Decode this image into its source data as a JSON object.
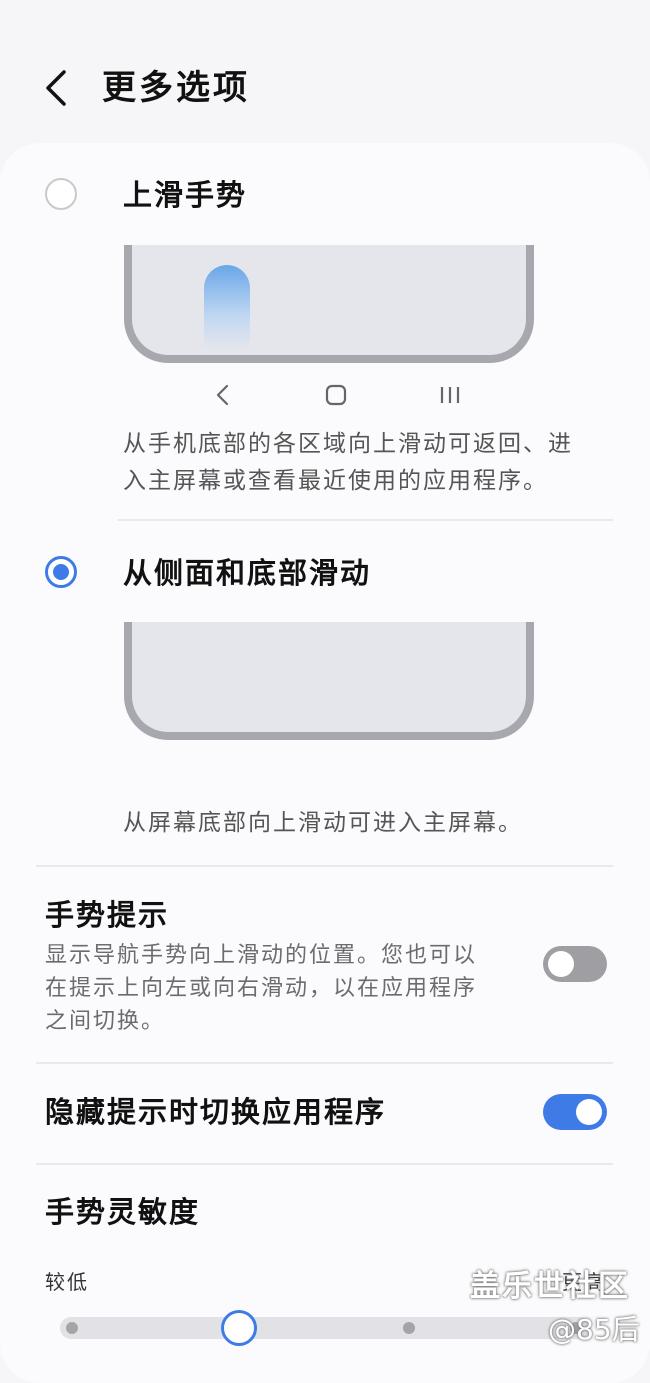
{
  "header": {
    "title": "更多选项",
    "back_icon": "chevron-left-icon"
  },
  "options": [
    {
      "label": "上滑手势",
      "selected": false,
      "description_line1": "从手机底部的各区域向上滑动可返回、进",
      "description_line2": "入主屏幕或查看最近使用的应用程序。"
    },
    {
      "label": "从侧面和底部滑动",
      "selected": true,
      "description": "从屏幕底部向上滑动可进入主屏幕。"
    }
  ],
  "nav_icons": [
    "back-key-icon",
    "home-key-icon",
    "recents-key-icon"
  ],
  "gesture_hint": {
    "title": "手势提示",
    "line1": "显示导航手势向上滑动的位置。您也可以",
    "line2": "在提示上向左或向右滑动，以在应用程序",
    "line3": "之间切换。",
    "enabled": false
  },
  "hide_hint_switch": {
    "title": "隐藏提示时切换应用程序",
    "enabled": true
  },
  "sensitivity": {
    "title": "手势灵敏度",
    "low_label": "较低",
    "high_label": "更高",
    "level": 2,
    "levels": 5
  },
  "watermark": {
    "line1": "盖乐世社区",
    "line2": "@85后"
  },
  "colors": {
    "accent": "#3e7be6",
    "toggle_off": "#9e9ea3"
  }
}
